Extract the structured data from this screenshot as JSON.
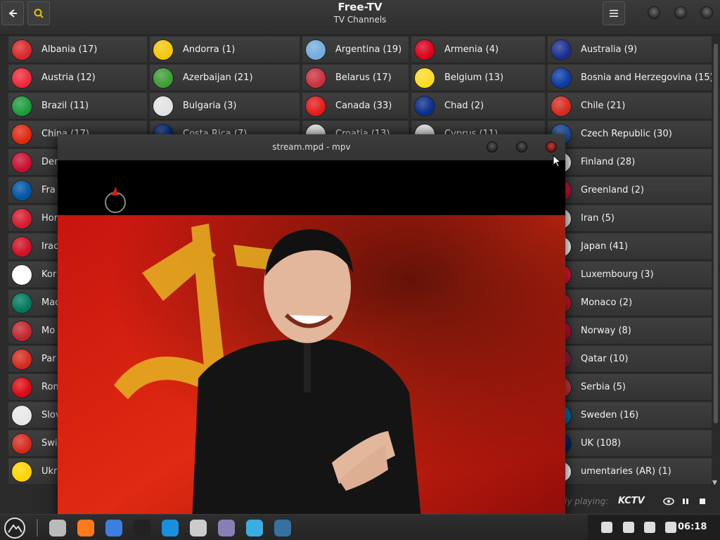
{
  "app": {
    "title": "Free-TV",
    "subtitle": "TV Channels"
  },
  "header_icons": {
    "back": "back-arrow-icon",
    "search": "search-icon",
    "menu": "hamburger-menu-icon"
  },
  "countries": [
    [
      "Albania (17)",
      "Andorra (1)",
      "Argentina (19)",
      "Armenia (4)",
      "Australia (9)"
    ],
    [
      "Austria (12)",
      "Azerbaijan (21)",
      "Belarus (17)",
      "Belgium (13)",
      "Bosnia and Herzegovina (15)"
    ],
    [
      "Brazil (11)",
      "Bulgaria (3)",
      "Canada (33)",
      "Chad (2)",
      "Chile (21)"
    ],
    [
      "China (17)",
      "Costa Rica (7)",
      "Croatia (13)",
      "Cyprus (11)",
      "Czech Republic (30)"
    ],
    [
      "Den",
      "",
      "",
      "",
      "Finland (28)"
    ],
    [
      "Fra",
      "",
      "",
      "",
      "Greenland (2)"
    ],
    [
      "Hon",
      "",
      "",
      "",
      "Iran (5)"
    ],
    [
      "Irac",
      "",
      "",
      "",
      "Japan (41)"
    ],
    [
      "Kor",
      "",
      "",
      "",
      "Luxembourg (3)"
    ],
    [
      "Mac",
      "",
      "",
      "",
      "Monaco (2)"
    ],
    [
      "Mo",
      "",
      "",
      "",
      "Norway (8)"
    ],
    [
      "Par",
      "",
      "",
      "",
      "Qatar (10)"
    ],
    [
      "Ron",
      "",
      "",
      "",
      "Serbia (5)"
    ],
    [
      "Slov",
      "",
      "",
      "",
      "Sweden (16)"
    ],
    [
      "Swi",
      "",
      "",
      "",
      "UK (108)"
    ],
    [
      "Ukr",
      "",
      "",
      "",
      "umentaries (AR) (1)"
    ]
  ],
  "flag_colors": [
    [
      "#d8282a",
      "#f3c70a",
      "#74acdf",
      "#d9001a",
      "#1c2f8f"
    ],
    [
      "#ed2939",
      "#3f9c35",
      "#c8313e",
      "#fdda24",
      "#0b3ba5"
    ],
    [
      "#1d9b3c",
      "#e2e2e2",
      "#e41b1b",
      "#0b2d8c",
      "#d52b1e"
    ],
    [
      "#de2910",
      "#002b7f",
      "#e8e8e8",
      "#e8e8e8",
      "#1b4fa0"
    ],
    [
      "#c8102e",
      "",
      "",
      "",
      "#f0f0f0"
    ],
    [
      "#0055a4",
      "",
      "",
      "",
      "#c8102e"
    ],
    [
      "#d51b2d",
      "",
      "",
      "",
      "#e8e8e8"
    ],
    [
      "#ce1126",
      "",
      "",
      "",
      "#ffffff"
    ],
    [
      "#ffffff",
      "",
      "",
      "",
      "#e8112d"
    ],
    [
      "#00785e",
      "",
      "",
      "",
      "#ce1126"
    ],
    [
      "#c1272d",
      "",
      "",
      "",
      "#ba0c2f"
    ],
    [
      "#d52b1e",
      "",
      "",
      "",
      "#8d1b3d"
    ],
    [
      "#db0a13",
      "",
      "",
      "",
      "#c6363c"
    ],
    [
      "#e8e8e8",
      "",
      "",
      "",
      "#006aa7"
    ],
    [
      "#d52b1e",
      "",
      "",
      "",
      "#012169"
    ],
    [
      "#ffd500",
      "",
      "",
      "",
      "#ffffff"
    ]
  ],
  "mpv": {
    "title": "stream.mpd - mpv"
  },
  "now_playing": {
    "label": "ly playing:",
    "channel": "KCTV"
  },
  "taskbar": {
    "apps": [
      "launcher-icon",
      "file-manager-icon",
      "firefox-icon",
      "chromium-icon",
      "terminal-icon",
      "store-icon",
      "archive-icon",
      "package-icon",
      "settings-icon",
      "python-icon"
    ],
    "clock": "06:18"
  }
}
